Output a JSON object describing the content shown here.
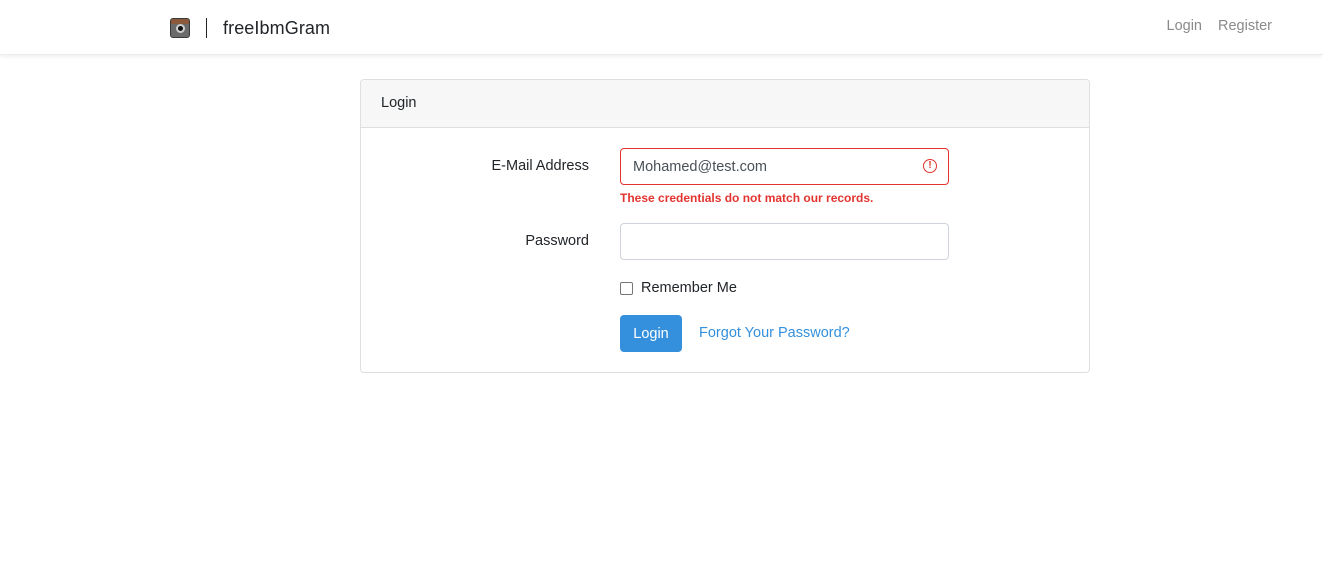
{
  "navbar": {
    "brand_name": "freeIbmGram",
    "brand_icon": "camera-icon",
    "links": {
      "login": "Login",
      "register": "Register"
    }
  },
  "card": {
    "header": "Login",
    "email": {
      "label": "E-Mail Address",
      "value": "Mohamed@test.com",
      "error": "These credentials do not match our records.",
      "error_icon": "exclamation-circle-icon"
    },
    "password": {
      "label": "Password",
      "value": ""
    },
    "remember": {
      "label": "Remember Me",
      "checked": false
    },
    "submit_label": "Login",
    "forgot_label": "Forgot Your Password?"
  },
  "colors": {
    "primary": "#3490dc",
    "danger": "#e3342f",
    "nav_link": "#8a8a8a",
    "card_header_bg": "#f7f7f7"
  }
}
